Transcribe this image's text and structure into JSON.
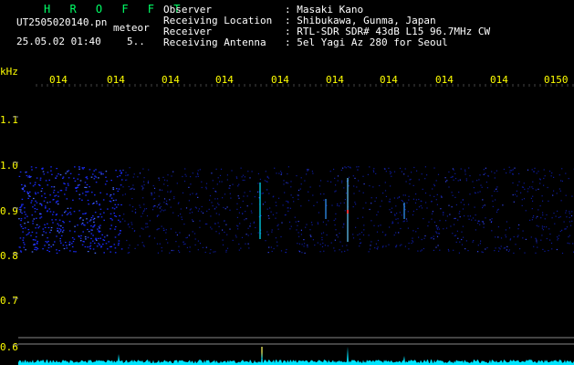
{
  "header": {
    "app_title": "H R O F F T",
    "filename": "UT2505020140.pn",
    "mode": "meteor",
    "datetime": "25.05.02 01:40",
    "count": "5..",
    "fields": [
      {
        "label": "Observer",
        "value": ": Masaki Kano"
      },
      {
        "label": "Receiving Location",
        "value": ": Shibukawa, Gunma, Japan"
      },
      {
        "label": "Receiver",
        "value": ": RTL-SDR SDR# 43dB L15 96.7MHz CW"
      },
      {
        "label": "Receiving Antenna",
        "value": ": 5el Yagi Az 280 for Seoul"
      }
    ]
  },
  "axes": {
    "y_unit": "kHz",
    "time_ticks": [
      "014",
      "014",
      "014",
      "014",
      "014",
      "014",
      "014",
      "014",
      "014",
      "0150"
    ],
    "freq_ticks": [
      "1.1",
      "1.0",
      "0.9",
      "0.8",
      "0.7",
      "0.6"
    ]
  },
  "colors": {
    "background": "#000000",
    "label_yellow": "#ffff00",
    "title_green": "#00ff66",
    "axis_gray": "#888888",
    "spectrum_cyan": "#00e5ff",
    "noise_blue": "#1a2cff"
  }
}
